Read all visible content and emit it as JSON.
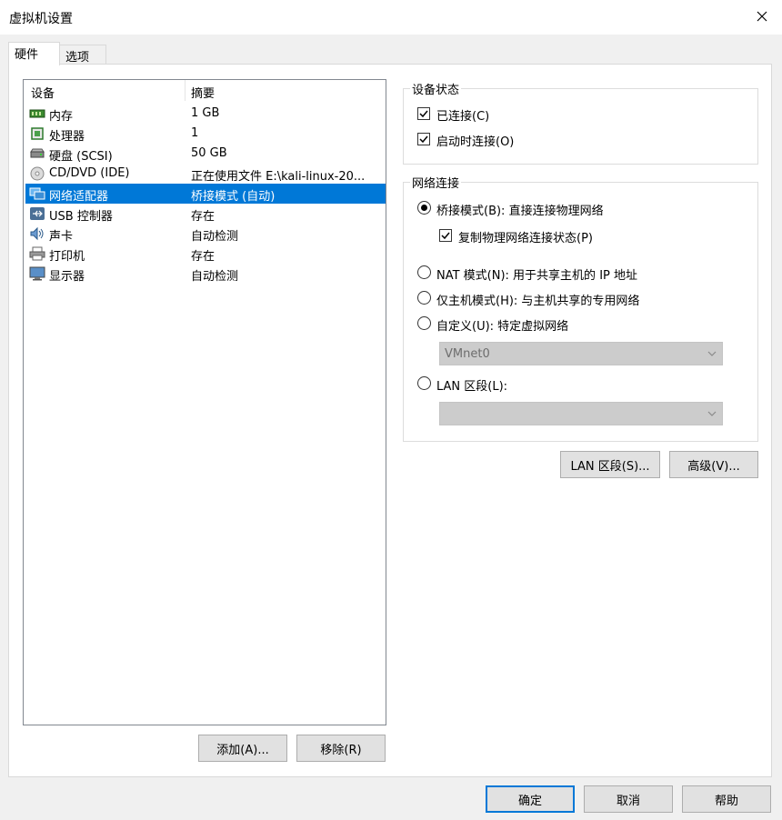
{
  "window": {
    "title": "虚拟机设置"
  },
  "tabs": [
    {
      "label": "硬件",
      "active": true
    },
    {
      "label": "选项",
      "active": false
    }
  ],
  "devices": {
    "header": {
      "device": "设备",
      "summary": "摘要"
    },
    "rows": [
      {
        "name": "内存",
        "summary": "1 GB",
        "icon": "memory-icon"
      },
      {
        "name": "处理器",
        "summary": "1",
        "icon": "processor-icon"
      },
      {
        "name": "硬盘 (SCSI)",
        "summary": "50 GB",
        "icon": "hard-disk-icon"
      },
      {
        "name": "CD/DVD (IDE)",
        "summary": "正在使用文件 E:\\kali-linux-20...",
        "icon": "cd-dvd-icon"
      },
      {
        "name": "网络适配器",
        "summary": "桥接模式 (自动)",
        "icon": "network-adapter-icon",
        "selected": true
      },
      {
        "name": "USB 控制器",
        "summary": "存在",
        "icon": "usb-icon"
      },
      {
        "name": "声卡",
        "summary": "自动检测",
        "icon": "sound-card-icon"
      },
      {
        "name": "打印机",
        "summary": "存在",
        "icon": "printer-icon"
      },
      {
        "name": "显示器",
        "summary": "自动检测",
        "icon": "display-icon"
      }
    ],
    "add_label": "添加(A)...",
    "remove_label": "移除(R)"
  },
  "device_status": {
    "legend": "设备状态",
    "connected": {
      "label": "已连接(C)",
      "checked": true
    },
    "connect_at_power_on": {
      "label": "启动时连接(O)",
      "checked": true
    }
  },
  "network": {
    "legend": "网络连接",
    "bridged": {
      "label": "桥接模式(B): 直接连接物理网络",
      "selected": true
    },
    "replicate": {
      "label": "复制物理网络连接状态(P)",
      "checked": true
    },
    "nat": {
      "label": "NAT 模式(N): 用于共享主机的 IP 地址",
      "selected": false
    },
    "host_only": {
      "label": "仅主机模式(H): 与主机共享的专用网络",
      "selected": false
    },
    "custom": {
      "label": "自定义(U): 特定虚拟网络",
      "selected": false
    },
    "custom_select": "VMnet0",
    "lan_segment": {
      "label": "LAN 区段(L):",
      "selected": false
    },
    "lan_select": ""
  },
  "buttons": {
    "lan_segments": "LAN 区段(S)...",
    "advanced": "高级(V)...",
    "ok": "确定",
    "cancel": "取消",
    "help": "帮助"
  },
  "colors": {
    "selection": "#0078d7",
    "window_bg": "#f0f0f0",
    "panel_bg": "#ffffff"
  }
}
